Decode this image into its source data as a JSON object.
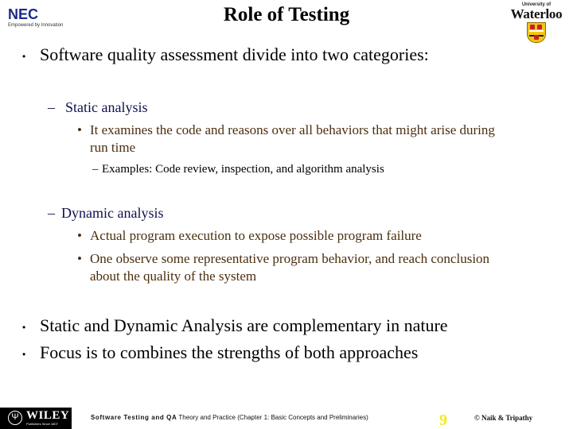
{
  "header": {
    "title": "Role of Testing",
    "left_logo": {
      "name": "NEC",
      "tagline": "Empowered by Innovation"
    },
    "right_logo": {
      "top_text": "University of",
      "name": "Waterloo"
    }
  },
  "colors": {
    "level1_text": "#000000",
    "level2_text": "#10104f",
    "level3_text": "#4b2e0e",
    "slide_number": "#f5e82b",
    "nec_blue": "#1a2a8a"
  },
  "content": {
    "bullets": [
      {
        "text": "Software quality assessment divide into two categories:",
        "children": [
          {
            "marker": "–",
            "text": "Static analysis",
            "children": [
              {
                "marker": "•",
                "text_line1": "It examines the code and reasons over all behaviors that might arise during",
                "text_line2": "run time",
                "children": [
                  {
                    "marker": "–",
                    "text": "Examples: Code review, inspection, and algorithm analysis"
                  }
                ]
              }
            ]
          },
          {
            "marker": "–",
            "text": "Dynamic analysis",
            "children": [
              {
                "marker": "•",
                "text": "Actual program execution to expose possible program failure"
              },
              {
                "marker": "•",
                "text_line1": "One observe some representative program behavior, and reach conclusion",
                "text_line2": "about the quality of the system"
              }
            ]
          }
        ]
      },
      {
        "text": "Static and Dynamic Analysis are complementary in nature"
      },
      {
        "text": "Focus is to combines the strengths of both approaches"
      }
    ],
    "bullet_marker": "•"
  },
  "footer": {
    "publisher_logo": {
      "name": "WILEY",
      "subtext": "Publishers Since 1807"
    },
    "book_title_bold": "Software Testing and QA",
    "book_title_rest": " Theory and Practice (Chapter 1: Basic Concepts and Preliminaries)",
    "slide_number": "9",
    "copyright": "© Naik & Tripathy"
  }
}
